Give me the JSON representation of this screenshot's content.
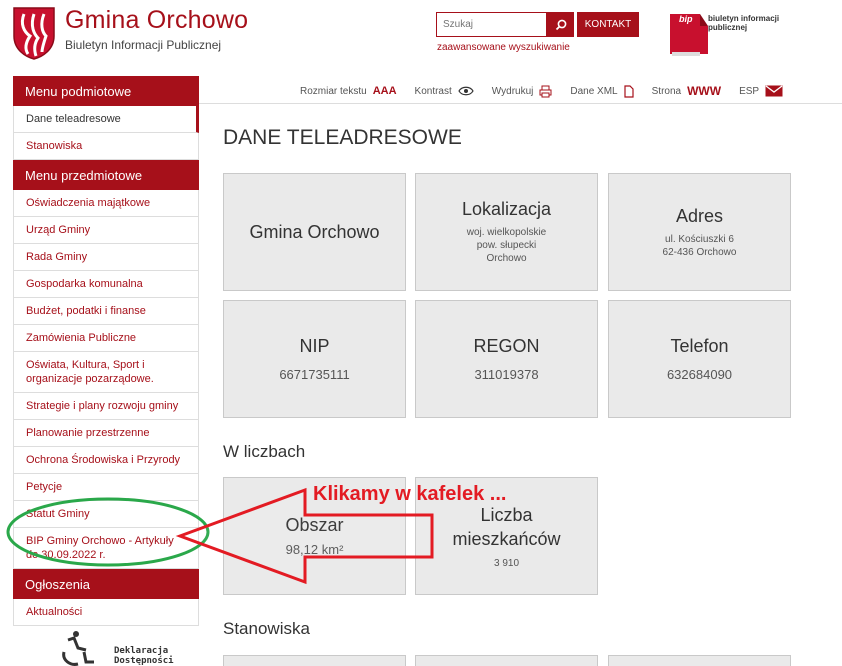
{
  "header": {
    "title": "Gmina Orchowo",
    "subtitle": "Biuletyn Informacji Publicznej",
    "search_placeholder": "Szukaj",
    "contact_label": "KONTAKT",
    "advanced_search": "zaawansowane wyszukiwanie",
    "bip_logo_text": "bip",
    "bip_logo_lines": "biuletyn informacji publicznej"
  },
  "toolbar": {
    "items": [
      {
        "label": "Rozmiar tekstu",
        "icon_text": "AAA",
        "icon": "text-size-icon"
      },
      {
        "label": "Kontrast",
        "icon": "eye-icon"
      },
      {
        "label": "Wydrukuj",
        "icon": "printer-icon"
      },
      {
        "label": "Dane XML",
        "icon": "xml-file-icon"
      },
      {
        "label": "Strona",
        "icon_text": "WWW",
        "icon": "www-icon"
      },
      {
        "label": "ESP",
        "icon": "envelope-icon"
      }
    ]
  },
  "sidebar": {
    "subject_menu": "Menu podmiotowe",
    "subject_items": [
      "Dane teleadresowe",
      "Stanowiska"
    ],
    "object_menu": "Menu przedmiotowe",
    "object_items": [
      "Oświadczenia majątkowe",
      "Urząd Gminy",
      "Rada Gminy",
      "Gospodarka komunalna",
      "Budżet, podatki i finanse",
      "Zamówienia Publiczne",
      "Oświata, Kultura, Sport i organizacje pozarządowe.",
      "Strategie i plany rozwoju gminy",
      "Planowanie przestrzenne",
      "Ochrona Środowiska i Przyrody",
      "Petycje",
      "Statut Gminy",
      "BIP Gminy Orchowo - Artykuły do 30.09.2022 r."
    ],
    "announcements": "Ogłoszenia",
    "announcement_items": [
      "Aktualności"
    ],
    "declaration": "Deklaracja Dostępności"
  },
  "main": {
    "title": "DANE TELEADRESOWE",
    "tiles": [
      {
        "title": "Gmina Orchowo"
      },
      {
        "title": "Lokalizacja",
        "lines": [
          "woj. wielkopolskie",
          "pow. słupecki",
          "Orchowo"
        ]
      },
      {
        "title": "Adres",
        "lines": [
          "ul. Kościuszki 6",
          "62-436 Orchowo"
        ]
      },
      {
        "title": "NIP",
        "value": "6671735111"
      },
      {
        "title": "REGON",
        "value": "311019378"
      },
      {
        "title": "Telefon",
        "value": "632684090"
      }
    ],
    "numbers_title": "W liczbach",
    "number_tiles": [
      {
        "title": "Obszar",
        "value": "98,12 km²"
      },
      {
        "title": "Liczba mieszkańców",
        "value": "3 910"
      }
    ],
    "positions_title": "Stanowiska"
  },
  "annotation": {
    "text": "Klikamy w kafelek ...",
    "color": "#e31b23",
    "ellipse_color": "#2aa84a"
  },
  "colors": {
    "brand": "#a6101a",
    "tile_bg": "#eaeaea"
  }
}
